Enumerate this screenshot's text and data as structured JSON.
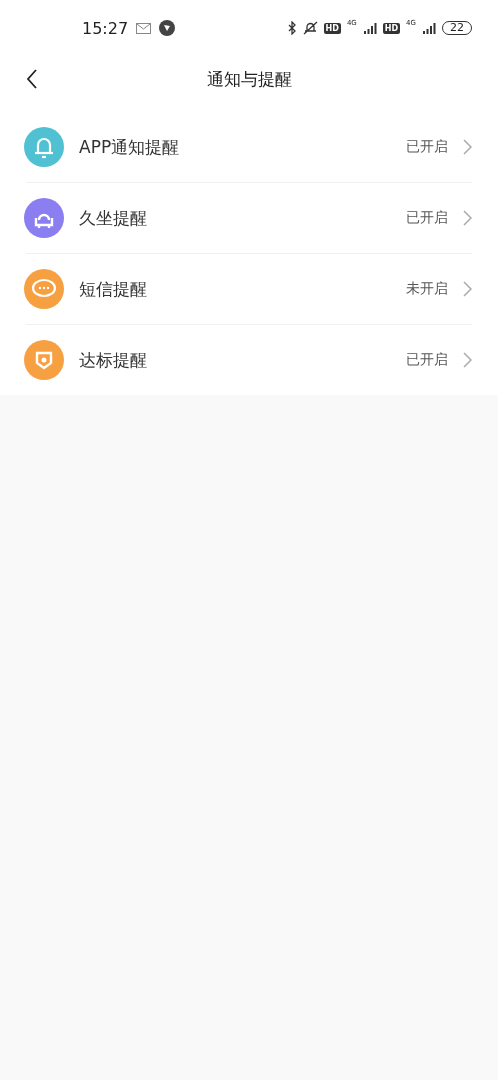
{
  "status_bar": {
    "time": "15:27",
    "hd_1": "HD",
    "network_1": "4G",
    "hd_2": "HD",
    "network_2": "4G",
    "battery": "22"
  },
  "header": {
    "title": "通知与提醒"
  },
  "items": [
    {
      "kind": "bell",
      "color": "#4fc1d3",
      "label": "APP通知提醒",
      "status": "已开启"
    },
    {
      "kind": "sofa",
      "color": "#8a7ef0",
      "label": "久坐提醒",
      "status": "已开启"
    },
    {
      "kind": "chat",
      "color": "#f7a042",
      "label": "短信提醒",
      "status": "未开启"
    },
    {
      "kind": "badge",
      "color": "#f7a042",
      "label": "达标提醒",
      "status": "已开启"
    }
  ]
}
